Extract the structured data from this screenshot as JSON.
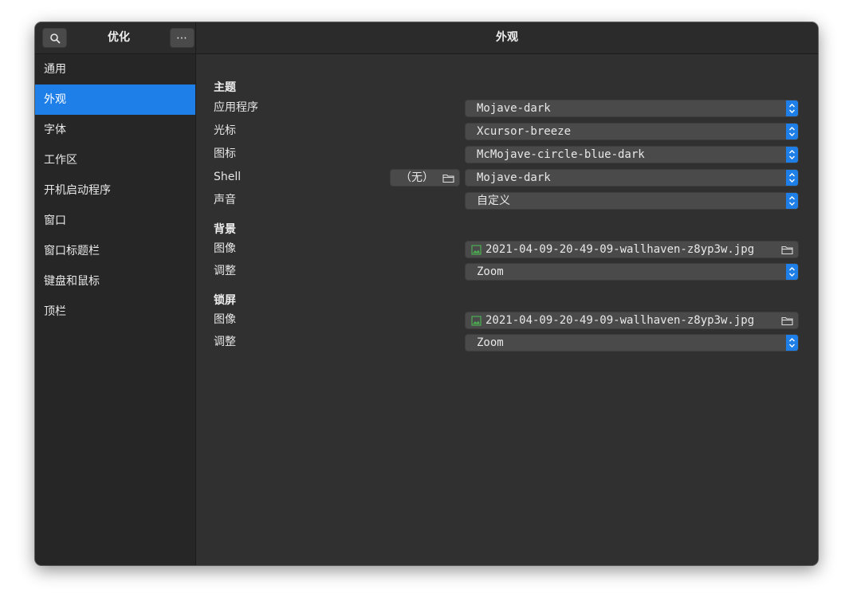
{
  "titlebar": {
    "sidebar_title": "优化",
    "page_title": "外观",
    "search_icon": "search-icon",
    "more_icon": "more-icon",
    "more_label": "⋯"
  },
  "sidebar": {
    "items": [
      {
        "label": "通用"
      },
      {
        "label": "外观"
      },
      {
        "label": "字体"
      },
      {
        "label": "工作区"
      },
      {
        "label": "开机启动程序"
      },
      {
        "label": "窗口"
      },
      {
        "label": "窗口标题栏"
      },
      {
        "label": "键盘和鼠标"
      },
      {
        "label": "顶栏"
      }
    ],
    "active_index": 1
  },
  "theme": {
    "heading": "主题",
    "applications": {
      "label": "应用程序",
      "value": "Mojave-dark"
    },
    "cursor": {
      "label": "光标",
      "value": "Xcursor-breeze"
    },
    "icons": {
      "label": "图标",
      "value": "McMojave-circle-blue-dark"
    },
    "shell": {
      "label": "Shell",
      "file_value": "（无）",
      "value": "Mojave-dark"
    },
    "sound": {
      "label": "声音",
      "value": "自定义"
    }
  },
  "background": {
    "heading": "背景",
    "image": {
      "label": "图像",
      "value": "2021-04-09-20-49-09-wallhaven-z8yp3w.jpg"
    },
    "adjustment": {
      "label": "调整",
      "value": "Zoom"
    }
  },
  "lockscreen": {
    "heading": "锁屏",
    "image": {
      "label": "图像",
      "value": "2021-04-09-20-49-09-wallhaven-z8yp3w.jpg"
    },
    "adjustment": {
      "label": "调整",
      "value": "Zoom"
    }
  },
  "colors": {
    "accent": "#1f7fe8",
    "window_bg": "#303030",
    "sidebar_bg": "#262626",
    "control_bg": "#4a4a4a",
    "image_icon": "#4caf50"
  }
}
